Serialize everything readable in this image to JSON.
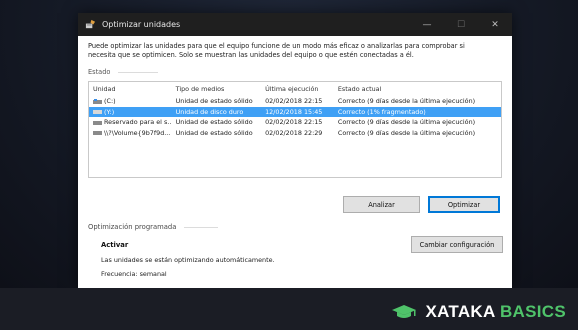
{
  "window": {
    "title": "Optimizar unidades",
    "description": "Puede optimizar las unidades para que el equipo funcione de un modo más eficaz o analizarlas para comprobar si necesita que se optimicen. Solo se muestran las unidades del equipo o que estén conectadas a él."
  },
  "status_section": {
    "label": "Estado",
    "columns": [
      "Unidad",
      "Tipo de medios",
      "Última ejecución",
      "Estado actual"
    ],
    "rows": [
      {
        "unit": "(C:)",
        "media": "Unidad de estado sólido",
        "last": "02/02/2018 22:15",
        "status": "Correcto (9 días desde la última ejecución)",
        "selected": false
      },
      {
        "unit": "(Y:)",
        "media": "Unidad de disco duro",
        "last": "12/02/2018 15:45",
        "status": "Correcto (1% fragmentado)",
        "selected": true
      },
      {
        "unit": "Reservado para el s...",
        "media": "Unidad de estado sólido",
        "last": "02/02/2018 22:15",
        "status": "Correcto (9 días desde la última ejecución)",
        "selected": false
      },
      {
        "unit": "\\\\?\\Volume{9b7f9d...",
        "media": "Unidad de estado sólido",
        "last": "02/02/2018 22:29",
        "status": "Correcto (9 días desde la última ejecución)",
        "selected": false
      }
    ]
  },
  "buttons": {
    "analyze": "Analizar",
    "optimize": "Optimizar",
    "change_config": "Cambiar configuración"
  },
  "scheduled": {
    "label": "Optimización programada",
    "state": "Activar",
    "auto_text": "Las unidades se están optimizando automáticamente.",
    "frequency": "Frecuencia: semanal"
  },
  "brand": {
    "name_prefix": "XATAKA",
    "name_suffix": "BASICS",
    "accent_color": "#4fc36a"
  }
}
